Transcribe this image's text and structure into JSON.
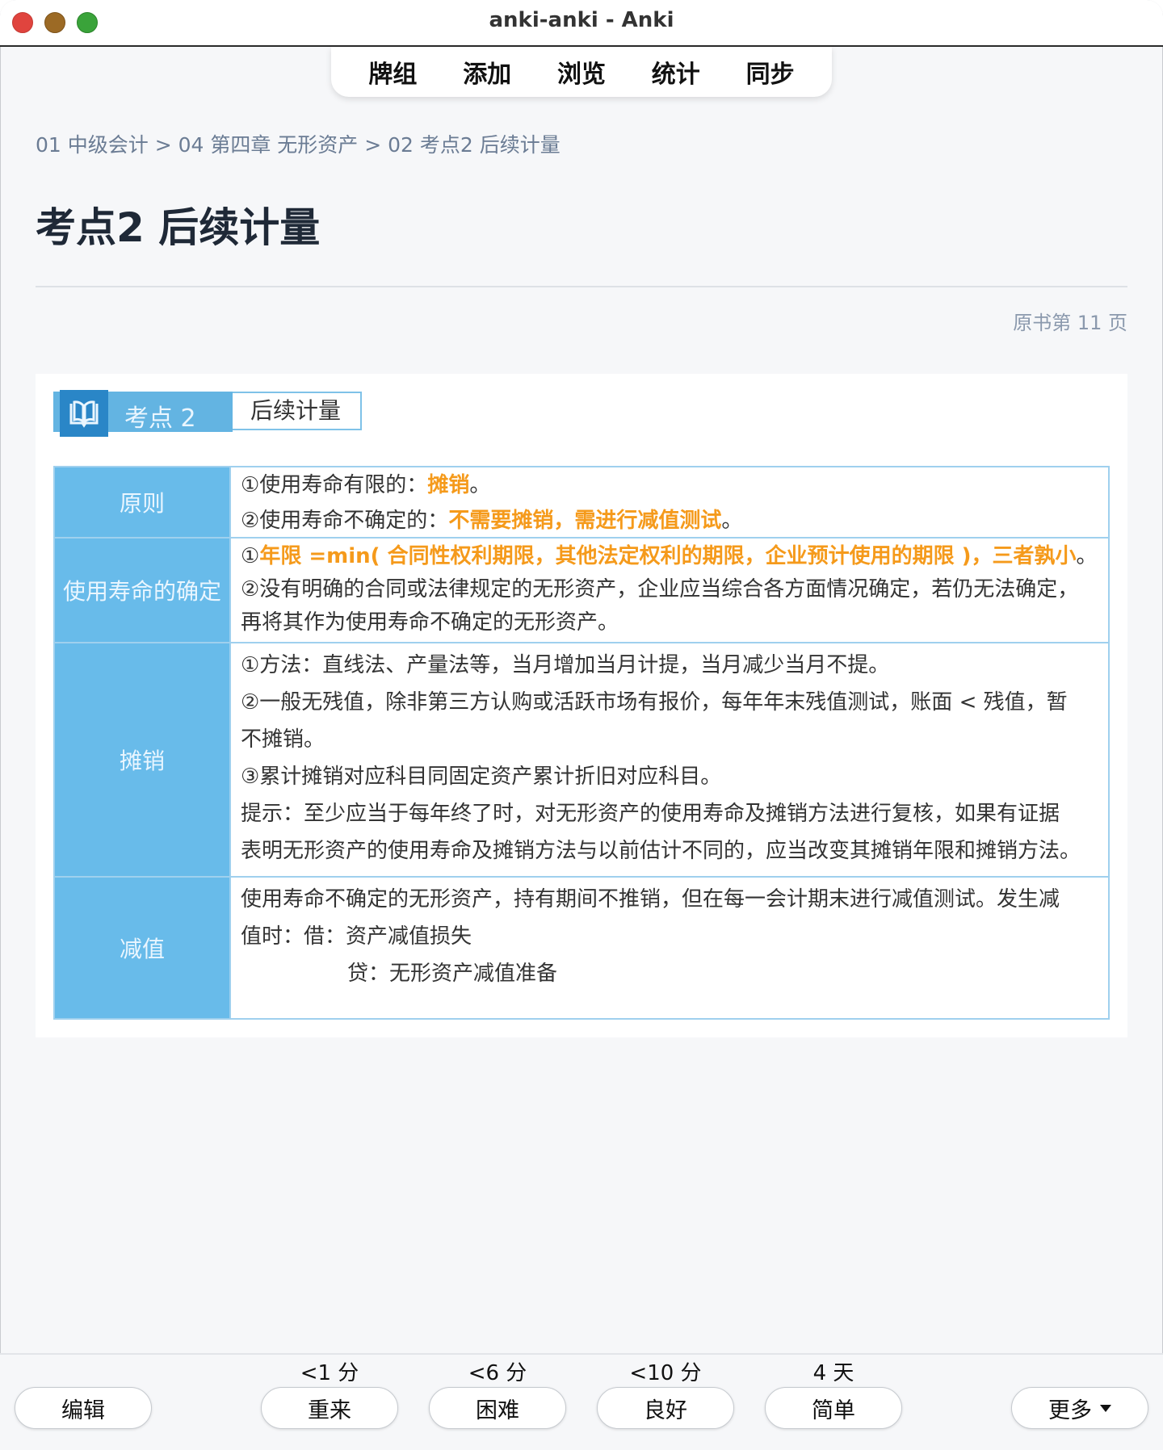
{
  "window": {
    "title": "anki-anki - Anki"
  },
  "toptabs": [
    "牌组",
    "添加",
    "浏览",
    "统计",
    "同步"
  ],
  "card": {
    "breadcrumb": "01 中级会计 > 04 第四章 无形资产 > 02 考点2 后续计量",
    "title": "考点2 后续计量",
    "page_ref": "原书第 11 页",
    "figure": {
      "badge_icon": "book-icon",
      "badge_text": "考点 2",
      "subtitle": "后续计量",
      "rows": [
        {
          "label": "原则",
          "lines": [
            {
              "prefix": "①使用寿命有限的：",
              "highlight": "摊销",
              "suffix": "。"
            },
            {
              "prefix": "②使用寿命不确定的：",
              "highlight": "不需要摊销，需进行减值测试",
              "suffix": "。"
            }
          ]
        },
        {
          "label": "使用寿命的确定",
          "lines": [
            {
              "prefix": "①",
              "highlight": "年限 =min( 合同性权利期限，其他法定权利的期限，企业预计使用的期限 )，三者孰小",
              "suffix": "。"
            },
            {
              "text": "②没有明确的合同或法律规定的无形资产，企业应当综合各方面情况确定，若仍无法确定，"
            },
            {
              "text": "再将其作为使用寿命不确定的无形资产。"
            }
          ]
        },
        {
          "label": "摊销",
          "lines": [
            {
              "text": "①方法：直线法、产量法等，当月增加当月计提，当月减少当月不提。"
            },
            {
              "text": "②一般无残值，除非第三方认购或活跃市场有报价，每年年末残值测试，账面 < 残值，暂"
            },
            {
              "text": "不摊销。"
            },
            {
              "text": "③累计摊销对应科目同固定资产累计折旧对应科目。"
            },
            {
              "text": "提示：至少应当于每年终了时，对无形资产的使用寿命及摊销方法进行复核，如果有证据"
            },
            {
              "text": "表明无形资产的使用寿命及摊销方法与以前估计不同的，应当改变其摊销年限和摊销方法。"
            }
          ]
        },
        {
          "label": "减值",
          "lines": [
            {
              "text": "使用寿命不确定的无形资产，持有期间不推销，但在每一会计期末进行减值测试。发生减"
            },
            {
              "text": "值时：借：资产减值损失"
            },
            {
              "text": "贷：无形资产减值准备",
              "indent": true
            }
          ]
        }
      ]
    }
  },
  "bottombar": {
    "edit": "编辑",
    "more": "更多",
    "answers": [
      {
        "interval": "<1 分",
        "label": "重来"
      },
      {
        "interval": "<6 分",
        "label": "困难"
      },
      {
        "interval": "<10 分",
        "label": "良好"
      },
      {
        "interval": "4 天",
        "label": "简单"
      }
    ]
  },
  "colors": {
    "accent_blue": "#68bbea",
    "highlight_orange": "#f59a1b",
    "close": "#e0443e",
    "minimize": "#9c6a25",
    "zoom": "#3aa33a"
  }
}
